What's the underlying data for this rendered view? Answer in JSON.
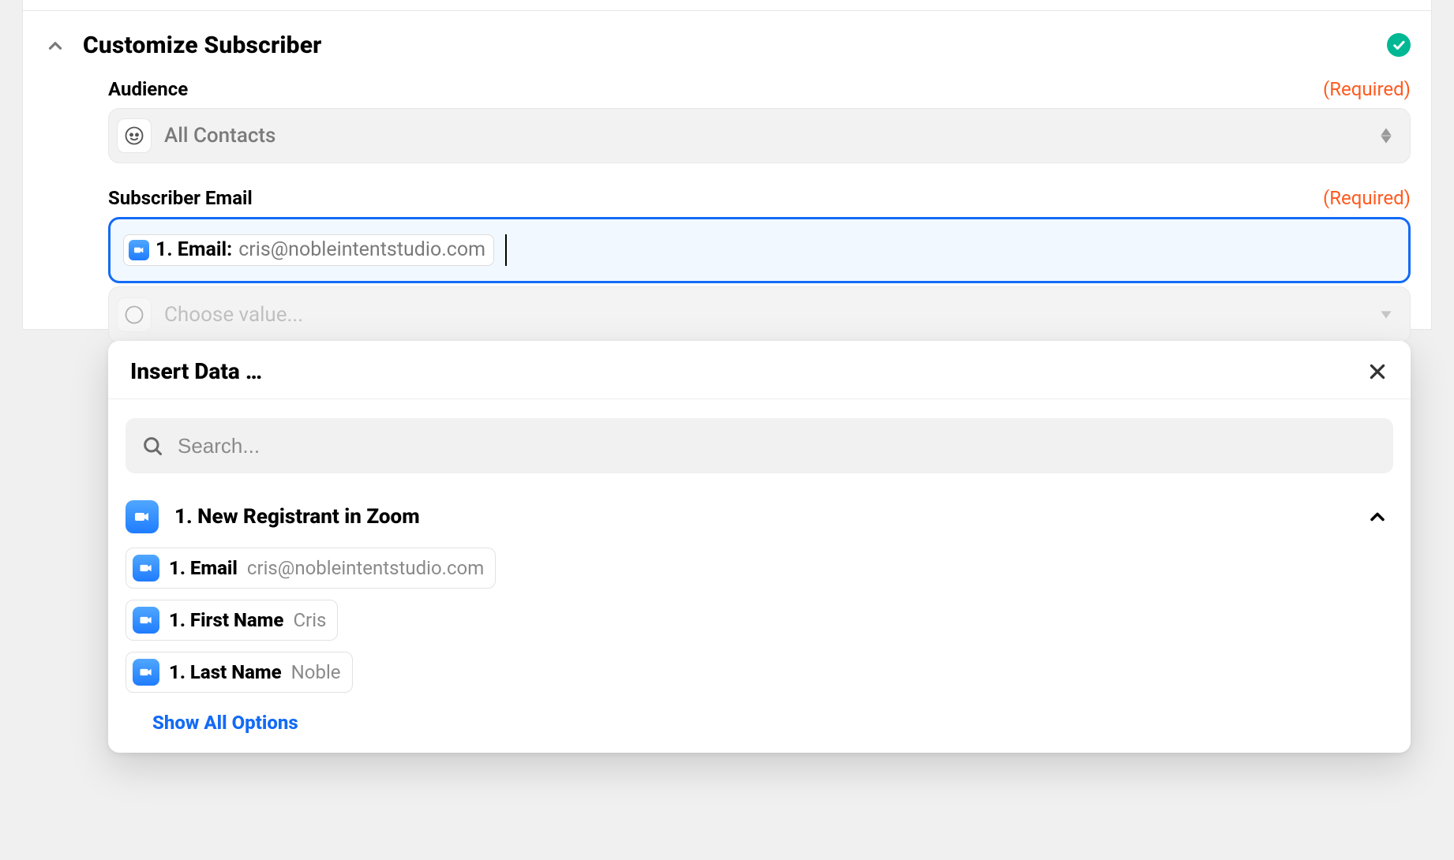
{
  "section": {
    "title": "Customize Subscriber"
  },
  "fields": {
    "audience": {
      "label": "Audience",
      "required_text": "(Required)",
      "value": "All Contacts"
    },
    "email": {
      "label": "Subscriber Email",
      "required_text": "(Required)",
      "pill": {
        "prefix": "1. Email:",
        "value": "cris@nobleintentstudio.com"
      }
    }
  },
  "popover": {
    "title": "Insert Data …",
    "search_placeholder": "Search...",
    "group": {
      "title": "1. New Registrant in Zoom"
    },
    "options": [
      {
        "label": "1. Email",
        "sample": "cris@nobleintentstudio.com"
      },
      {
        "label": "1. First Name",
        "sample": "Cris"
      },
      {
        "label": "1. Last Name",
        "sample": "Noble"
      }
    ],
    "show_all_label": "Show All Options"
  },
  "ghost": {
    "value": "Choose value..."
  }
}
